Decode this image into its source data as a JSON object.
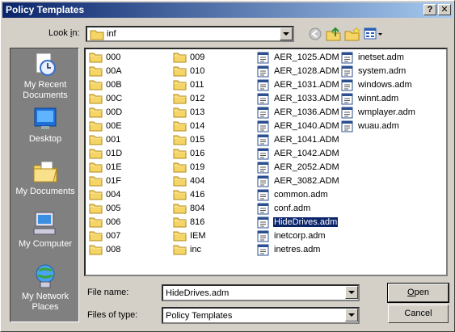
{
  "window": {
    "title": "Policy Templates",
    "help_glyph": "?",
    "close_glyph": "✕"
  },
  "toolbar": {
    "look_in_prefix": "Look ",
    "look_in_accel": "i",
    "look_in_suffix": "n:",
    "look_in_value": "inf",
    "back_icon": "back-icon",
    "up_icon": "up-folder-icon",
    "new_folder_icon": "new-folder-icon",
    "views_icon": "views-menu-icon"
  },
  "places": [
    {
      "label_line1": "My Recent",
      "label_line2": "Documents",
      "icon": "recent-documents-icon"
    },
    {
      "label_line1": "Desktop",
      "label_line2": "",
      "icon": "desktop-icon"
    },
    {
      "label_line1": "My Documents",
      "label_line2": "",
      "icon": "my-documents-icon"
    },
    {
      "label_line1": "My Computer",
      "label_line2": "",
      "icon": "my-computer-icon"
    },
    {
      "label_line1": "My Network",
      "label_line2": "Places",
      "icon": "network-places-icon"
    }
  ],
  "files": {
    "col1": [
      "000",
      "00A",
      "00B",
      "00C",
      "00D",
      "00E",
      "001",
      "01D",
      "01E",
      "01F",
      "004",
      "005",
      "006",
      "007",
      "008"
    ],
    "col2": [
      "009",
      "010",
      "011",
      "012",
      "013",
      "014",
      "015",
      "016",
      "019",
      "404",
      "416",
      "804",
      "816",
      "IEM",
      "inc"
    ],
    "col3": [
      "AER_1025.ADM",
      "AER_1028.ADM",
      "AER_1031.ADM",
      "AER_1033.ADM",
      "AER_1036.ADM",
      "AER_1040.ADM",
      "AER_1041.ADM",
      "AER_1042.ADM",
      "AER_2052.ADM",
      "AER_3082.ADM",
      "common.adm",
      "conf.adm",
      "HideDrives.adm",
      "inetcorp.adm",
      "inetres.adm"
    ],
    "col4": [
      "inetset.adm",
      "system.adm",
      "windows.adm",
      "winnt.adm",
      "wmplayer.adm",
      "wuau.adm"
    ],
    "selected": "HideDrives.adm"
  },
  "footer": {
    "file_name_label": "File name:",
    "file_name_value": "HideDrives.adm",
    "file_type_label": "Files of type:",
    "file_type_value": "Policy Templates",
    "open_accel": "O",
    "open_rest": "pen",
    "cancel_label": "Cancel"
  },
  "colors": {
    "title_start": "#0a246a",
    "title_end": "#a6caf0",
    "selection": "#0a246a",
    "dialog": "#d4d0c8",
    "places_bg": "#808080"
  }
}
